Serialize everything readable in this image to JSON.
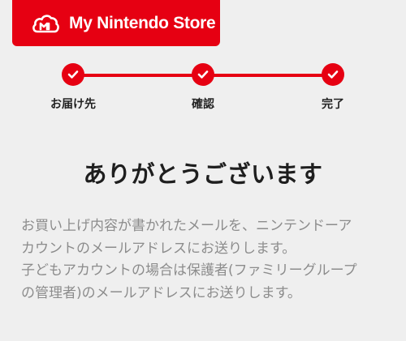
{
  "header": {
    "brand_text": "My Nintendo Store",
    "brand_color": "#e60012",
    "logo_icon": "cloud-mushroom-logo"
  },
  "stepper": {
    "steps": [
      {
        "label": "お届け先",
        "status": "complete"
      },
      {
        "label": "確認",
        "status": "complete"
      },
      {
        "label": "完了",
        "status": "complete"
      }
    ],
    "icon": "check-icon"
  },
  "main": {
    "title": "ありがとうございます",
    "message_lines": [
      "お買い上げ内容が書かれたメールを、ニンテンドーア",
      "カウントのメールアドレスにお送りします。",
      "子どもアカウントの場合は保護者(ファミリーグループ",
      "の管理者)のメールアドレスにお送りします。"
    ]
  }
}
